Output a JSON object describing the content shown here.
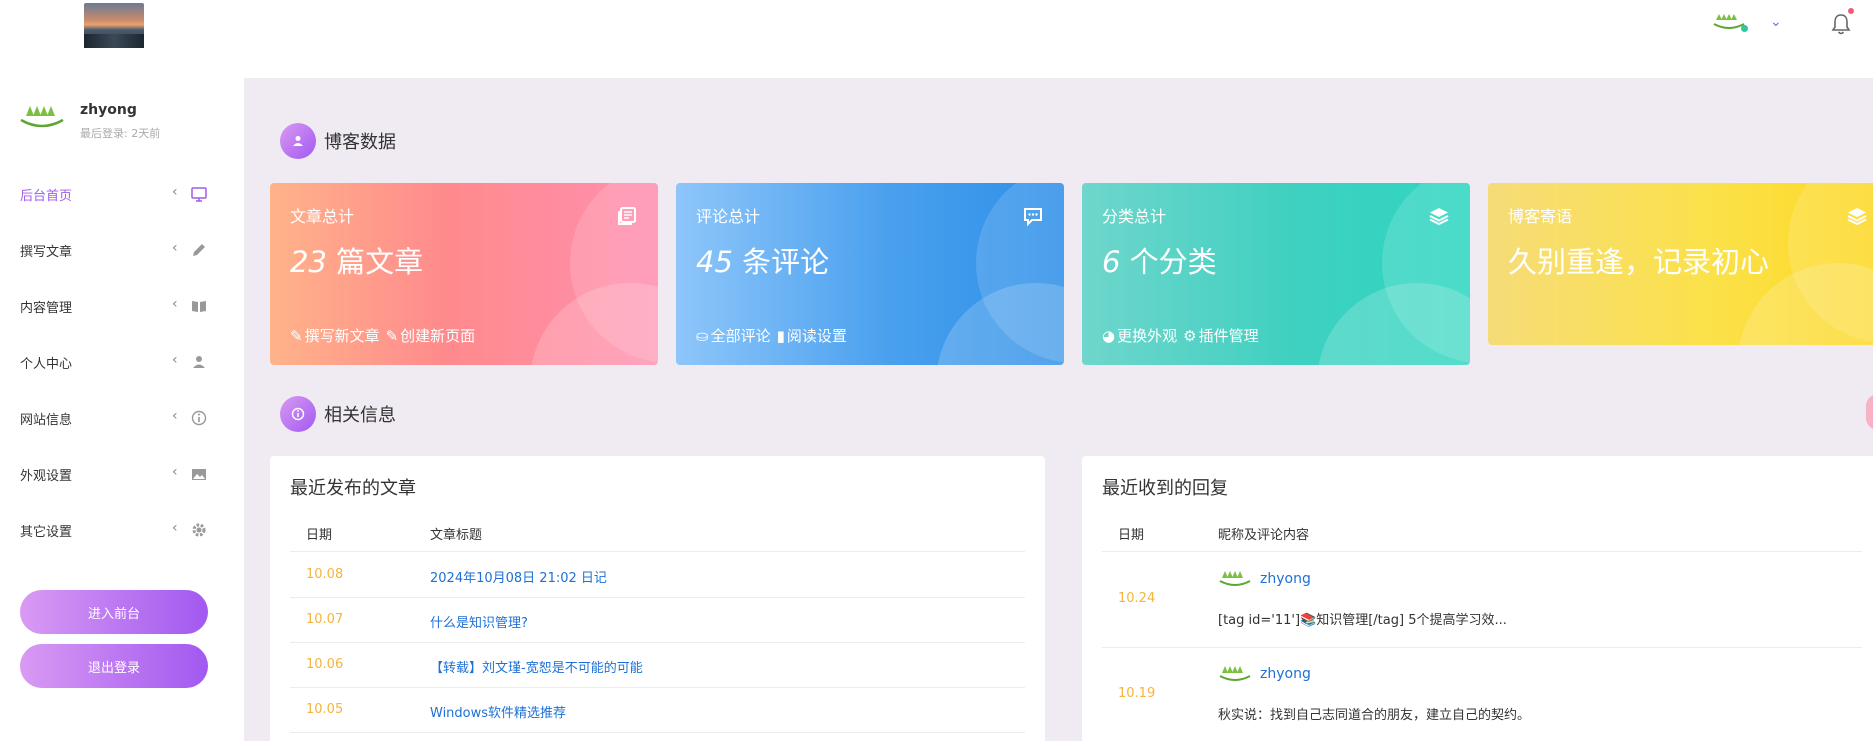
{
  "header": {
    "logo_icon": "landscape-photo",
    "notification_icon": "bell-icon",
    "dropdown_icon": "chevron-down-icon"
  },
  "user": {
    "name": "zhyong",
    "last_login": "最后登录: 2天前"
  },
  "sidebar": {
    "items": [
      {
        "label": "后台首页",
        "icon": "monitor-icon",
        "active": true
      },
      {
        "label": "撰写文章",
        "icon": "pencil-icon",
        "active": false
      },
      {
        "label": "内容管理",
        "icon": "book-icon",
        "active": false
      },
      {
        "label": "个人中心",
        "icon": "user-icon",
        "active": false
      },
      {
        "label": "网站信息",
        "icon": "info-icon",
        "active": false
      },
      {
        "label": "外观设置",
        "icon": "image-icon",
        "active": false
      },
      {
        "label": "其它设置",
        "icon": "gear-icon",
        "active": false
      }
    ],
    "enter_front_label": "进入前台",
    "logout_label": "退出登录"
  },
  "stats_section": {
    "title": "博客数据"
  },
  "cards": [
    {
      "label": "文章总计",
      "num": "23",
      "unit": " 篇文章",
      "links": [
        "撰写新文章",
        "创建新页面"
      ]
    },
    {
      "label": "评论总计",
      "num": "45",
      "unit": " 条评论",
      "links": [
        "全部评论",
        "阅读设置"
      ]
    },
    {
      "label": "分类总计",
      "num": "6",
      "unit": " 个分类",
      "links": [
        "更换外观",
        "插件管理"
      ]
    },
    {
      "label": "博客寄语",
      "text": "久别重逢，记录初心"
    }
  ],
  "info_section": {
    "title": "相关信息"
  },
  "recent_posts": {
    "title": "最近发布的文章",
    "col_date": "日期",
    "col_title": "文章标题",
    "rows": [
      {
        "date": "10.08",
        "title": "2024年10月08日 21:02 日记"
      },
      {
        "date": "10.07",
        "title": "什么是知识管理?"
      },
      {
        "date": "10.06",
        "title": "【转载】刘文瑾-宽恕是不可能的可能"
      },
      {
        "date": "10.05",
        "title": "Windows软件精选推荐"
      }
    ]
  },
  "recent_replies": {
    "title": "最近收到的回复",
    "col_date": "日期",
    "col_content": "昵称及评论内容",
    "rows": [
      {
        "date": "10.24",
        "name": "zhyong",
        "text": "[tag id='11']📚知识管理[/tag] 5个提高学习效..."
      },
      {
        "date": "10.19",
        "name": "zhyong",
        "text": "秋实说：找到自己志同道合的朋友，建立自己的契约。"
      }
    ]
  },
  "colors": {
    "accent": "#a05de6",
    "date": "#f5b43e",
    "link": "#1e70d6"
  }
}
